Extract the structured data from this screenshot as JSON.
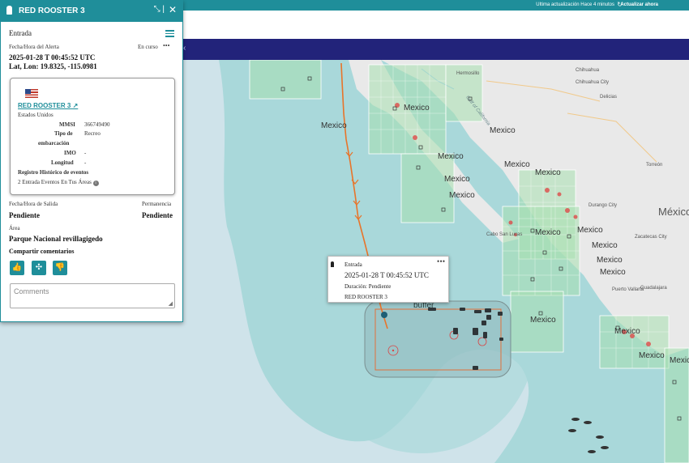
{
  "topbar": {
    "last_update": "Ultima actualización Hace 4 minutos",
    "refresh_label": "Actualizar ahora",
    "refresh_icon": "refresh-icon"
  },
  "panel": {
    "title": "RED ROOSTER 3",
    "section": "Entrada",
    "alert_label": "Fecha/Hora del Alerta",
    "status": "En curso",
    "datetime": "2025-01-28 T 00:45:52 UTC",
    "latlon": "Lat, Lon: 19.8325, -115.0981",
    "vessel": {
      "name": "RED ROOSTER 3",
      "country": "Estados Unidos",
      "mmsi_label": "MMSI",
      "mmsi": "366749490",
      "type_label_1": "Tipo de",
      "type_label_2": "embarcación",
      "type": "Recreo",
      "imo_label": "IMO",
      "imo": "-",
      "length_label": "Longitud",
      "length": "-",
      "history_label": "Registro Histórico de eventos",
      "history_value": "2 Entrada Eventos En Tus Áreas"
    },
    "departure_label": "Fecha/Hora de Salida",
    "departure": "Pendiente",
    "stay_label": "Permanencia",
    "stay": "Pendiente",
    "area_label": "Área",
    "area": "Parque Nacional revillagigedo",
    "share_label": "Compartir comentarios",
    "comments_placeholder": "Comments"
  },
  "popup": {
    "type": "Entrada",
    "datetime": "2025-01-28 T 00:45:52 UTC",
    "duration": "Duración: Pendiente",
    "vessel": "RED ROOSTER 3"
  },
  "map_labels": {
    "hermosillo": "Hermosillo",
    "chihuahua": "Chihuahua",
    "chihuahua_city": "Chihuahua City",
    "delicias": "Delicias",
    "gulf": "Gulf of California",
    "torreon": "Torreón",
    "durango": "Durango City",
    "mexico_big": "México",
    "zacatecas": "Zacatecas City",
    "cabo": "Cabo San Lucas",
    "puerto_vallarta": "Puerto Vallarta",
    "guadalajara": "Guadalajara",
    "buffer": "buffer",
    "mexico": "Mexico"
  },
  "colors": {
    "accent": "#1f8e9a",
    "nav": "#22237a",
    "track": "#e8742a",
    "zone": "#a8e0b0",
    "land": "#e8e8e8",
    "ocean": "#cfe3ea",
    "buffer": "#9ec9c9"
  }
}
